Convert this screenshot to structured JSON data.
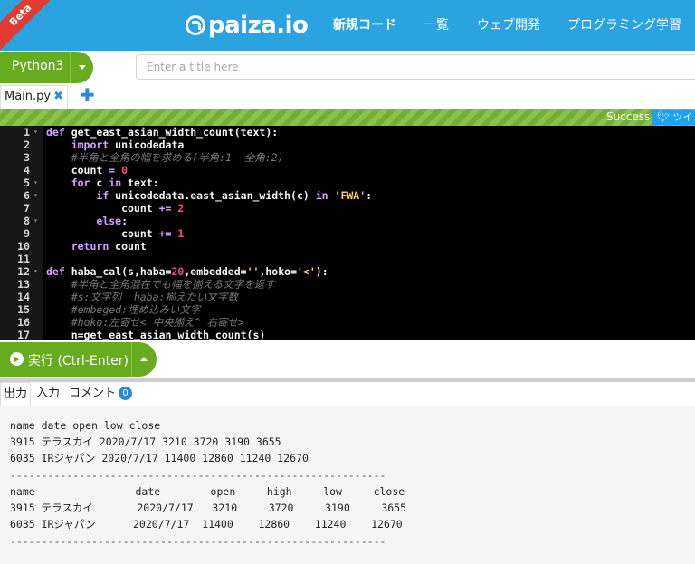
{
  "header": {
    "beta": "Beta",
    "logo": "paiza.io",
    "nav": [
      "新規コード",
      "一覧",
      "ウェブ開発",
      "プログラミング学習"
    ]
  },
  "toolbar": {
    "language": "Python3",
    "title_placeholder": "Enter a title here"
  },
  "files": {
    "tab": "Main.py",
    "close_glyph": "✖",
    "add_glyph": "✚"
  },
  "status": {
    "text": "Success",
    "tweet": "ツイ"
  },
  "editor": {
    "line_numbers": [
      "1",
      "2",
      "3",
      "4",
      "5",
      "6",
      "7",
      "8",
      "9",
      "10",
      "11",
      "12",
      "13",
      "14",
      "15",
      "16",
      "17"
    ]
  },
  "run": {
    "label": "実行 (Ctrl-Enter)"
  },
  "output_tabs": {
    "output": "出力",
    "input": "入力",
    "comments": "コメント",
    "comment_count": "0"
  },
  "output_lines": [
    "name date open low close",
    "3915 テラスカイ 2020/7/17 3210 3720 3190 3655",
    "6035 IRジャパン 2020/7/17 11400 12860 11240 12670",
    "------------------------------------------------------------",
    "name                date        open     high     low     close",
    "3915 テラスカイ       2020/7/17   3210     3720     3190     3655",
    "6035 IRジャパン      2020/7/17  11400    12860    11240    12670",
    "------------------------------------------------------------"
  ],
  "colors": {
    "header_blue": "#2aa3e0",
    "button_green": "#67ac1f",
    "editor_bg": "#000000",
    "keyword": "#d5a1ff",
    "number": "#ff4b7a",
    "string": "#ffd24a",
    "comment": "#7a7a7a"
  }
}
